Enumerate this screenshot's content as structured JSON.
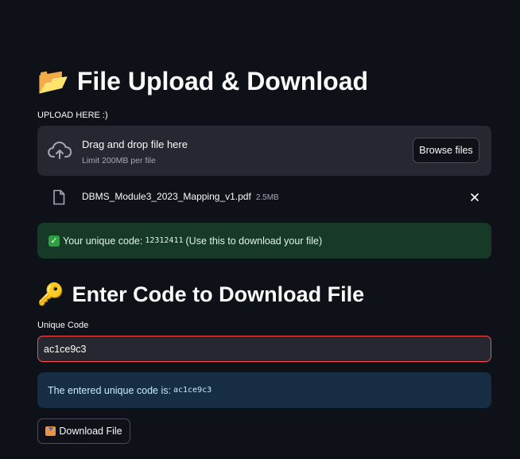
{
  "upload_section": {
    "title": "File Upload & Download",
    "title_icon": "open-folder-icon",
    "label": "UPLOAD HERE :)",
    "dropzone_title": "Drag and drop file here",
    "dropzone_limit": "Limit 200MB per file",
    "browse_label": "Browse files",
    "uploaded_file": {
      "name": "DBMS_Module3_2023_Mapping_v1.pdf",
      "size": "2.5MB"
    },
    "success_prefix": "Your unique code:",
    "success_code": "12312411",
    "success_suffix": "(Use this to download your file)"
  },
  "download_section": {
    "title": "Enter Code to Download File",
    "title_icon": "key-icon",
    "input_label": "Unique Code",
    "input_value": "ac1ce9c3",
    "info_prefix": "The entered unique code is:",
    "info_code": "ac1ce9c3",
    "download_label": "Download File"
  },
  "colors": {
    "background": "#0e1117",
    "surface": "#262730",
    "success_bg": "#173928",
    "info_bg": "#172d43",
    "input_border": "#ff4b4b"
  }
}
